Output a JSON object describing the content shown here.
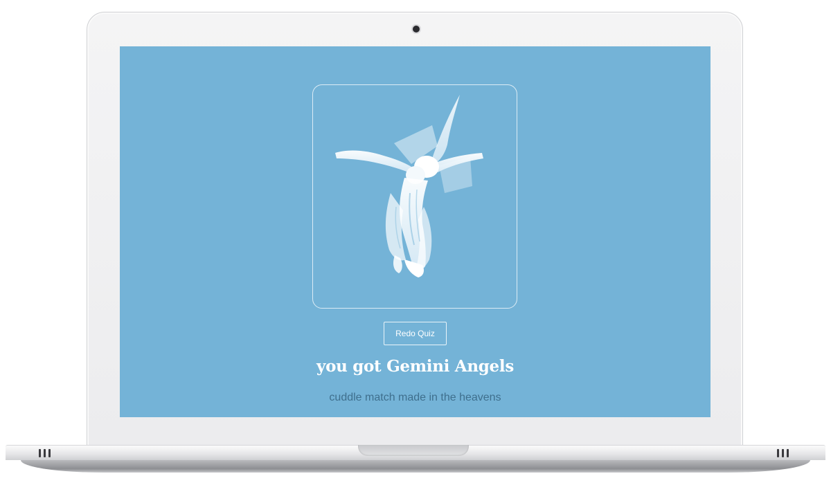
{
  "quiz_result": {
    "redo_button_label": "Redo Quiz",
    "title": "you got Gemini Angels",
    "subtitle": "cuddle match made in the heavens"
  },
  "colors": {
    "screen_background": "#74b3d7",
    "title_color": "#ffffff",
    "subtitle_color": "#3f6f8d"
  },
  "image": {
    "icon": "angel-sculpture-image"
  }
}
